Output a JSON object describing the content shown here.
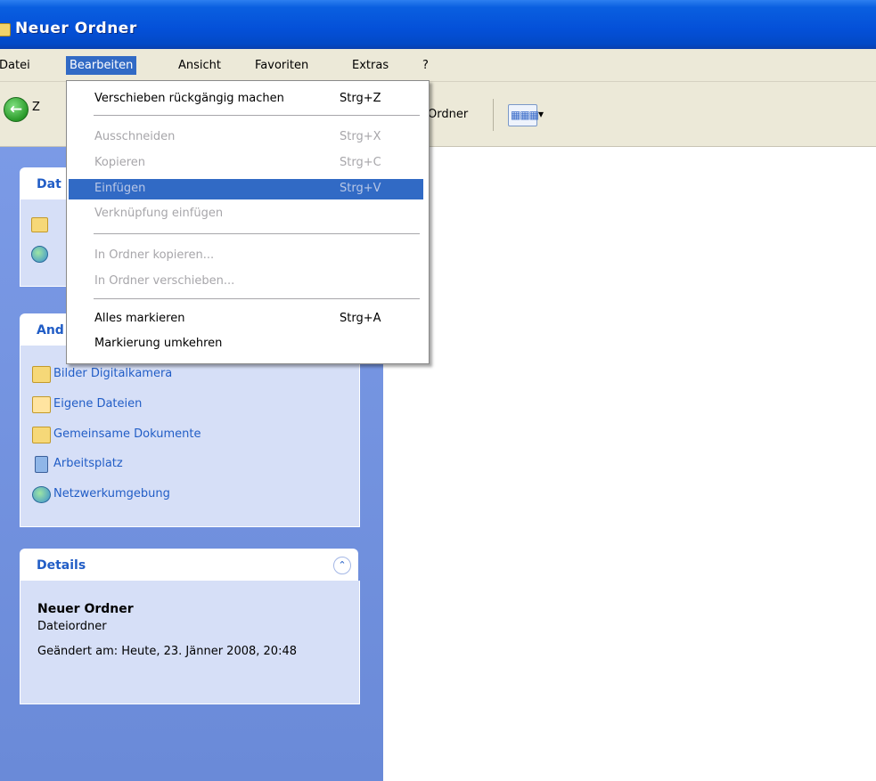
{
  "window": {
    "title": "Neuer Ordner"
  },
  "menubar": {
    "items": [
      "Datei",
      "Bearbeiten",
      "Ansicht",
      "Favoriten",
      "Extras",
      "?"
    ]
  },
  "toolbar": {
    "back_label": "Z",
    "folders_label": "Ordner"
  },
  "edit_menu": {
    "items": [
      {
        "label": "Verschieben rückgängig machen",
        "shortcut": "Strg+Z"
      },
      {
        "label": "Ausschneiden",
        "shortcut": "Strg+X"
      },
      {
        "label": "Kopieren",
        "shortcut": "Strg+C"
      },
      {
        "label": "Einfügen",
        "shortcut": "Strg+V"
      },
      {
        "label": "Verknüpfung einfügen",
        "shortcut": ""
      },
      {
        "label": "In Ordner kopieren...",
        "shortcut": ""
      },
      {
        "label": "In Ordner verschieben...",
        "shortcut": ""
      },
      {
        "label": "Alles markieren",
        "shortcut": "Strg+A"
      },
      {
        "label": "Markierung umkehren",
        "shortcut": ""
      }
    ]
  },
  "task_pane": {
    "panel1_title_partial": "Dat",
    "panel2_title_partial": "And",
    "other_places": [
      {
        "label": "Bilder Digitalkamera",
        "icon": "folder-icon"
      },
      {
        "label": "Eigene Dateien",
        "icon": "my-documents-icon"
      },
      {
        "label": "Gemeinsame Dokumente",
        "icon": "folder-icon"
      },
      {
        "label": "Arbeitsplatz",
        "icon": "computer-icon"
      },
      {
        "label": "Netzwerkumgebung",
        "icon": "network-icon"
      }
    ],
    "details": {
      "title": "Details",
      "name": "Neuer Ordner",
      "type": "Dateiordner",
      "modified": "Geändert am: Heute, 23. Jänner 2008, 20:48"
    }
  },
  "colors": {
    "titlebar": "#0450d8",
    "menu_highlight": "#316ac5",
    "task_pane": "#7b9ae6",
    "link": "#215dc6"
  }
}
